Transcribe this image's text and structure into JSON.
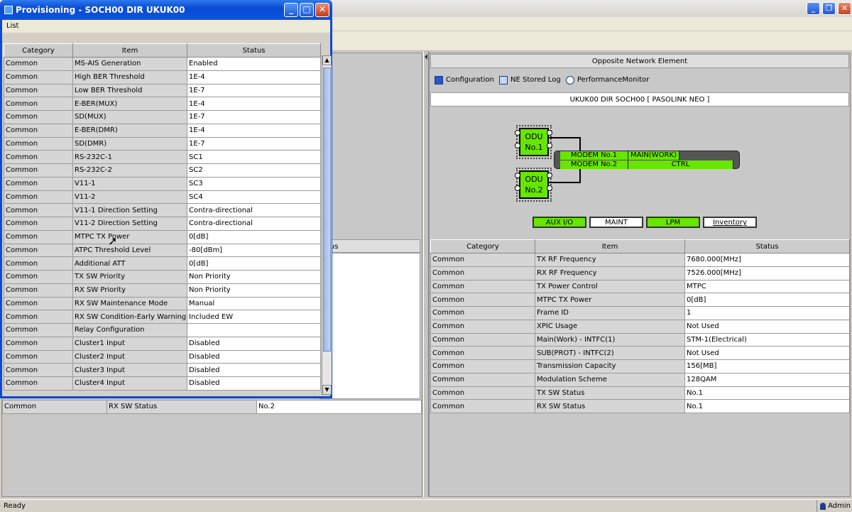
{
  "dialog": {
    "title": "Provisioning - SOCH00 DIR UKUK00",
    "menu": "List",
    "columns": [
      "Category",
      "Item",
      "Status"
    ],
    "rows": [
      [
        "Common",
        "MS-AIS Generation",
        "Enabled"
      ],
      [
        "Common",
        "High BER Threshold",
        "1E-4"
      ],
      [
        "Common",
        "Low BER Threshold",
        "1E-7"
      ],
      [
        "Common",
        "E-BER(MUX)",
        "1E-4"
      ],
      [
        "Common",
        "SD(MUX)",
        "1E-7"
      ],
      [
        "Common",
        "E-BER(DMR)",
        "1E-4"
      ],
      [
        "Common",
        "SD(DMR)",
        "1E-7"
      ],
      [
        "Common",
        "RS-232C-1",
        "SC1"
      ],
      [
        "Common",
        "RS-232C-2",
        "SC2"
      ],
      [
        "Common",
        "V11-1",
        "SC3"
      ],
      [
        "Common",
        "V11-2",
        "SC4"
      ],
      [
        "Common",
        "V11-1 Direction Setting",
        "Contra-directional"
      ],
      [
        "Common",
        "V11-2 Direction Setting",
        "Contra-directional"
      ],
      [
        "Common",
        "MTPC TX Power",
        "0[dB]"
      ],
      [
        "Common",
        "ATPC Threshold Level",
        "-80[dBm]"
      ],
      [
        "Common",
        "Additional ATT",
        "0[dB]"
      ],
      [
        "Common",
        "TX SW Priority",
        "Non Priority"
      ],
      [
        "Common",
        "RX SW Priority",
        "Non Priority"
      ],
      [
        "Common",
        "RX SW Maintenance Mode",
        "Manual"
      ],
      [
        "Common",
        "RX SW Condition-Early Warning",
        "Included EW"
      ],
      [
        "Common",
        "Relay Configuration",
        ""
      ],
      [
        "Common",
        "Cluster1 Input",
        "Disabled"
      ],
      [
        "Common",
        "Cluster2 Input",
        "Disabled"
      ],
      [
        "Common",
        "Cluster3 Input",
        "Disabled"
      ],
      [
        "Common",
        "Cluster4 Input",
        "Disabled"
      ]
    ]
  },
  "left_panel": {
    "status_header": "tus",
    "last_row": [
      "Common",
      "RX SW Status",
      "No.2"
    ]
  },
  "right_panel": {
    "header": "Opposite Network Element",
    "toolbar": {
      "configuration": "Configuration",
      "ne_stored_log": "NE Stored Log",
      "performance_monitor": "PerformanceMonitor"
    },
    "ne_title": "UKUK00 DIR SOCH00 [ PASOLINK NEO ]",
    "diagram": {
      "odu1_line1": "ODU",
      "odu1_line2": "No.1",
      "odu2_line1": "ODU",
      "odu2_line2": "No.2",
      "modem1": "MODEM No.1",
      "modem1_status": "MAIN(WORK)",
      "modem2": "MODEM No.2",
      "modem2_status": "CTRL",
      "buttons": {
        "aux_io": "AUX I/O",
        "maint": "MAINT",
        "lpm": "LPM",
        "inventory": "Inventory"
      }
    },
    "columns": [
      "Category",
      "Item",
      "Status"
    ],
    "rows": [
      [
        "Common",
        "TX RF Frequency",
        "7680.000[MHz]"
      ],
      [
        "Common",
        "RX RF Frequency",
        "7526.000[MHz]"
      ],
      [
        "Common",
        "TX Power Control",
        "MTPC"
      ],
      [
        "Common",
        "MTPC TX Power",
        "0[dB]"
      ],
      [
        "Common",
        "Frame ID",
        "1"
      ],
      [
        "Common",
        "XPIC Usage",
        "Not Used"
      ],
      [
        "Common",
        "Main(Work) - INTFC(1)",
        "STM-1(Electrical)"
      ],
      [
        "Common",
        "SUB(PROT) - INTFC(2)",
        "Not Used"
      ],
      [
        "Common",
        "Transmission Capacity",
        "156[MB]"
      ],
      [
        "Common",
        "Modulation Scheme",
        "128QAM"
      ],
      [
        "Common",
        "TX SW Status",
        "No.1"
      ],
      [
        "Common",
        "RX SW Status",
        "No.1"
      ]
    ]
  },
  "statusbar": {
    "left": "Ready",
    "user": "Admin"
  },
  "colors": {
    "accent_green": "#66e600",
    "title_blue": "#0a4ad4"
  }
}
